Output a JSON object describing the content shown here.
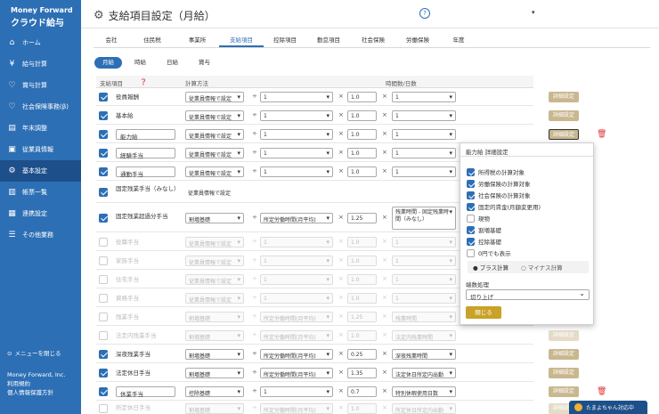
{
  "sidebar": {
    "brand": "Money Forward",
    "product": "クラウド給与",
    "items": [
      {
        "label": "ホーム",
        "icon": "home-icon"
      },
      {
        "label": "給与計算",
        "icon": "yen-icon"
      },
      {
        "label": "賞与計算",
        "icon": "medal-icon"
      },
      {
        "label": "社会保険事務(β)",
        "icon": "heart-icon"
      },
      {
        "label": "年末調整",
        "icon": "document-icon"
      },
      {
        "label": "従業員情報",
        "icon": "person-card-icon"
      },
      {
        "label": "基本設定",
        "icon": "gear-icon"
      },
      {
        "label": "帳票一覧",
        "icon": "report-icon"
      },
      {
        "label": "連携設定",
        "icon": "grid-icon"
      },
      {
        "label": "その他業務",
        "icon": "list-icon"
      }
    ],
    "close_menu": "メニューを閉じる",
    "company": "Money Forward, Inc.",
    "footer1": "利用規約",
    "footer2": "個人情報保護方針"
  },
  "header": {
    "title": "支給項目設定（月給）"
  },
  "tabs": [
    "会社",
    "住民税",
    "事業所",
    "支給項目",
    "控除項目",
    "勤怠項目",
    "社会保険",
    "労働保険",
    "年度"
  ],
  "pills": [
    "月給",
    "時給",
    "日給",
    "賞与"
  ],
  "table_header": {
    "col1": "支給項目",
    "col2": "計算方法",
    "col3": "時間数/日数"
  },
  "btn_detail": "詳細設定",
  "rows": [
    {
      "name": "役員報酬",
      "method": "従業員情報で設定",
      "m2": "1",
      "m3": "1.0",
      "m4": "1"
    },
    {
      "name": "基本給",
      "method": "従業員情報で設定",
      "m2": "1",
      "m3": "1.0",
      "m4": "1"
    },
    {
      "name": "能力給",
      "method": "従業員情報で設定",
      "m2": "1",
      "m3": "1.0",
      "m4": "1"
    },
    {
      "name": "経験手当",
      "method": "従業員情報で設定",
      "m2": "1",
      "m3": "1.0",
      "m4": "1"
    },
    {
      "name": "通勤手当",
      "method": "従業員情報で設定",
      "m2": "1",
      "m3": "1.0",
      "m4": "1"
    },
    {
      "name": "固定残業手当（みなし）",
      "method": "従業員情報で設定"
    },
    {
      "name": "固定残業超過分手当",
      "method": "割増基礎",
      "m2": "所定労働時間(月平均)",
      "m3": "1.25",
      "m4": "残業時間 - 固定残業時間（みなし）"
    },
    {
      "name": "役職手当",
      "method": "従業員情報で設定",
      "m2": "1",
      "m3": "1.0",
      "m4": "1"
    },
    {
      "name": "家族手当",
      "method": "従業員情報で設定",
      "m2": "1",
      "m3": "1.0",
      "m4": "1"
    },
    {
      "name": "住宅手当",
      "method": "従業員情報で設定",
      "m2": "1",
      "m3": "1.0",
      "m4": "1"
    },
    {
      "name": "資格手当",
      "method": "従業員情報で設定",
      "m2": "1",
      "m3": "1.0",
      "m4": "1"
    },
    {
      "name": "残業手当",
      "method": "割増基礎",
      "m2": "所定労働時間(月平均)",
      "m3": "1.25",
      "m4": "残業時間"
    },
    {
      "name": "法定内残業手当",
      "method": "割増基礎",
      "m2": "所定労働時間(月平均)",
      "m3": "1.0",
      "m4": "法定内残業時間"
    },
    {
      "name": "深夜残業手当",
      "method": "割増基礎",
      "m2": "所定労働時間(月平均)",
      "m3": "0.25",
      "m4": "深夜残業時間"
    },
    {
      "name": "法定休日手当",
      "method": "割増基礎",
      "m2": "所定労働時間(月平均)",
      "m3": "1.35",
      "m4": "法定休日所定内出勤"
    },
    {
      "name": "休業手当",
      "method": "控除基礎",
      "m2": "1",
      "m3": "0.7",
      "m4": "特別休暇使用日数"
    },
    {
      "name": "所定休日手当",
      "method": "割増基礎",
      "m2": "所定労働時間(月平均)",
      "m3": "1.0",
      "m4": "所定休日所定内出勤"
    }
  ],
  "popup": {
    "title": "能力給 詳細設定",
    "options": [
      "所得税の計算対象",
      "労働保険の計算対象",
      "社会保険の計算対象",
      "固定的賃金(月額変更用)",
      "現物",
      "割増基礎",
      "控除基礎",
      "0円でも表示"
    ],
    "radio_plus": "プラス計算",
    "radio_minus": "マイナス計算",
    "rounding_label": "端数処理",
    "rounding_value": "切り上げ",
    "close": "閉じる"
  },
  "chat": "たまよちゃん対応中",
  "colors": {
    "sidebar": "#2d6fb5",
    "accent": "#2d6fb5",
    "detail_button": "#c9b78f",
    "close_button": "#c9a227"
  }
}
